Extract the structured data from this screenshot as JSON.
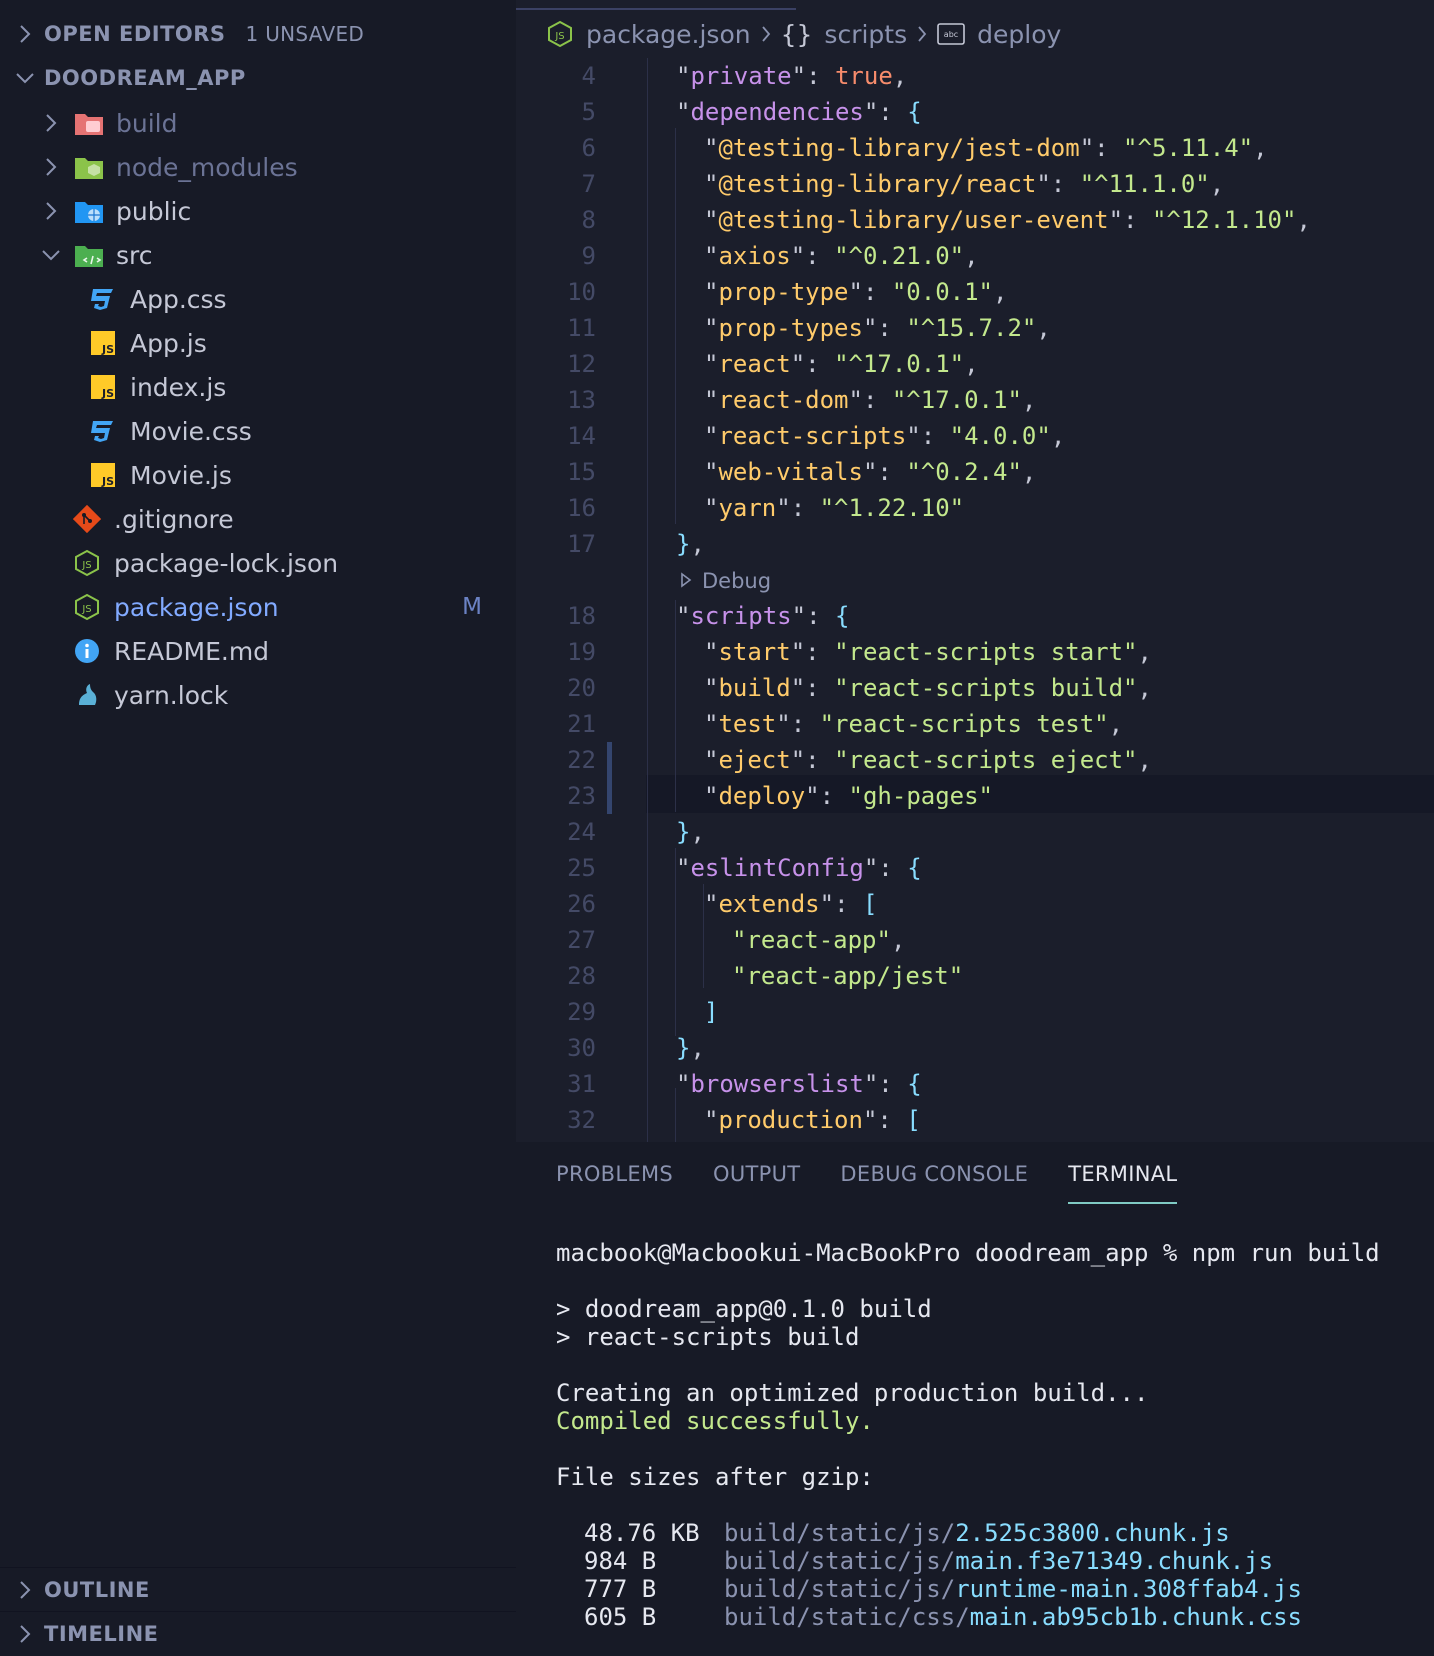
{
  "sidebar": {
    "open_editors": {
      "title": "OPEN EDITORS",
      "count": "1 UNSAVED"
    },
    "project": {
      "title": "DOODREAM_APP"
    },
    "items": [
      {
        "label": "build",
        "icon": "folder-build-icon",
        "color": "#6b7395"
      },
      {
        "label": "node_modules",
        "icon": "folder-node-icon",
        "color": "#6b7395"
      },
      {
        "label": "public",
        "icon": "folder-public-icon",
        "color": "#c5c8d6"
      },
      {
        "label": "src",
        "icon": "folder-src-icon",
        "color": "#c5c8d6"
      },
      {
        "label": "App.css",
        "icon": "css-icon",
        "color": "#c5c8d6"
      },
      {
        "label": "App.js",
        "icon": "js-icon",
        "color": "#c5c8d6"
      },
      {
        "label": "index.js",
        "icon": "js-icon",
        "color": "#c5c8d6"
      },
      {
        "label": "Movie.css",
        "icon": "css-icon",
        "color": "#c5c8d6"
      },
      {
        "label": "Movie.js",
        "icon": "js-icon",
        "color": "#c5c8d6"
      },
      {
        "label": ".gitignore",
        "icon": "git-icon",
        "color": "#c5c8d6"
      },
      {
        "label": "package-lock.json",
        "icon": "nodejs-icon",
        "color": "#c5c8d6"
      },
      {
        "label": "package.json",
        "icon": "nodejs-icon",
        "color": "#82aaff",
        "badge": "M"
      },
      {
        "label": "README.md",
        "icon": "info-icon",
        "color": "#c5c8d6"
      },
      {
        "label": "yarn.lock",
        "icon": "yarn-icon",
        "color": "#c5c8d6"
      }
    ],
    "outline": "OUTLINE",
    "timeline": "TIMELINE"
  },
  "breadcrumb": {
    "file": "package.json",
    "section": "scripts",
    "field": "deploy",
    "braces": "{}",
    "string_icon_text": "abc"
  },
  "code": {
    "lines": [
      {
        "n": "4",
        "text": "\"private\": true,"
      },
      {
        "n": "5",
        "text": "\"dependencies\": {"
      },
      {
        "n": "6",
        "text": "\"@testing-library/jest-dom\": \"^5.11.4\","
      },
      {
        "n": "7",
        "text": "\"@testing-library/react\": \"^11.1.0\","
      },
      {
        "n": "8",
        "text": "\"@testing-library/user-event\": \"^12.1.10\","
      },
      {
        "n": "9",
        "text": "\"axios\": \"^0.21.0\","
      },
      {
        "n": "10",
        "text": "\"prop-type\": \"0.0.1\","
      },
      {
        "n": "11",
        "text": "\"prop-types\": \"^15.7.2\","
      },
      {
        "n": "12",
        "text": "\"react\": \"^17.0.1\","
      },
      {
        "n": "13",
        "text": "\"react-dom\": \"^17.0.1\","
      },
      {
        "n": "14",
        "text": "\"react-scripts\": \"4.0.0\","
      },
      {
        "n": "15",
        "text": "\"web-vitals\": \"^0.2.4\","
      },
      {
        "n": "16",
        "text": "\"yarn\": \"^1.22.10\""
      },
      {
        "n": "17",
        "text": "},"
      },
      {
        "n": "18",
        "text": "\"scripts\": {"
      },
      {
        "n": "19",
        "text": "\"start\": \"react-scripts start\","
      },
      {
        "n": "20",
        "text": "\"build\": \"react-scripts build\","
      },
      {
        "n": "21",
        "text": "\"test\": \"react-scripts test\","
      },
      {
        "n": "22",
        "text": "\"eject\": \"react-scripts eject\","
      },
      {
        "n": "23",
        "text": "\"deploy\": \"gh-pages\""
      },
      {
        "n": "24",
        "text": "},"
      },
      {
        "n": "25",
        "text": "\"eslintConfig\": {"
      },
      {
        "n": "26",
        "text": "\"extends\": ["
      },
      {
        "n": "27",
        "text": "\"react-app\","
      },
      {
        "n": "28",
        "text": "\"react-app/jest\""
      },
      {
        "n": "29",
        "text": "]"
      },
      {
        "n": "30",
        "text": "},"
      },
      {
        "n": "31",
        "text": "\"browserslist\": {"
      },
      {
        "n": "32",
        "text": "\"production\": ["
      }
    ],
    "codelens": "Debug"
  },
  "panel": {
    "tabs": [
      "PROBLEMS",
      "OUTPUT",
      "DEBUG CONSOLE",
      "TERMINAL"
    ],
    "active_tab": "TERMINAL",
    "terminal": {
      "prompt": "macbook@Macbookui-MacBookPro doodream_app % npm run build",
      "script1": "> doodream_app@0.1.0 build",
      "script2": "> react-scripts build",
      "creating": "Creating an optimized production build...",
      "compiled": "Compiled successfully.",
      "sizes_header": "File sizes after gzip:",
      "files": [
        {
          "size": "48.76 KB",
          "dir": "build/static/js/",
          "name": "2.525c3800.chunk.js"
        },
        {
          "size": "984 B",
          "dir": "build/static/js/",
          "name": "main.f3e71349.chunk.js"
        },
        {
          "size": "777 B",
          "dir": "build/static/js/",
          "name": "runtime-main.308ffab4.js"
        },
        {
          "size": "605 B",
          "dir": "build/static/css/",
          "name": "main.ab95cb1b.chunk.css"
        }
      ]
    }
  }
}
